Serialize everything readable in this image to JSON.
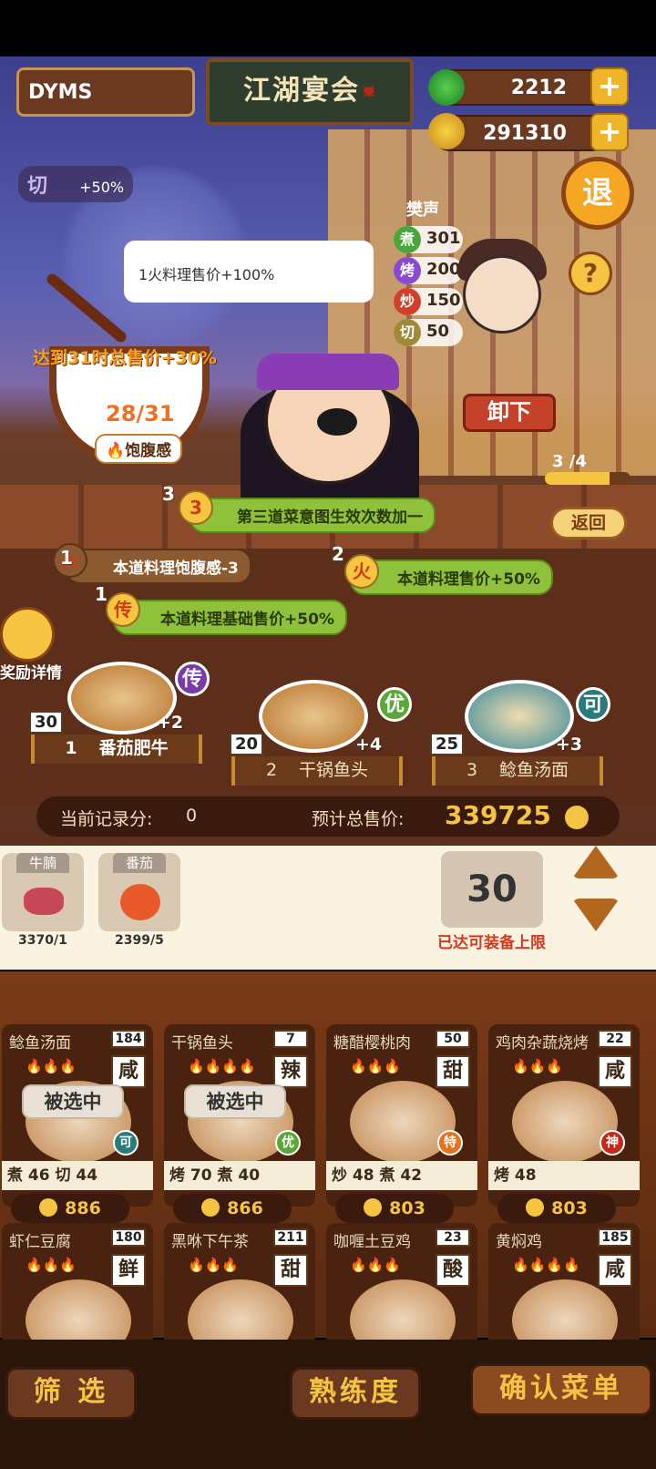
{
  "player": {
    "name": "DYMS"
  },
  "header": {
    "title": "江湖宴会",
    "stamp": "樂"
  },
  "currency": {
    "jade": "2212",
    "coin": "291310",
    "plus": "+"
  },
  "buff_chip": {
    "label": "切",
    "bonus": "+50%"
  },
  "exit_button": "退",
  "help_button": "?",
  "chef": {
    "name": "樊声",
    "stats": [
      {
        "icon": "煮",
        "value": "301",
        "color": "#4aa63a"
      },
      {
        "icon": "烤",
        "value": "200",
        "color": "#8a4ad0"
      },
      {
        "icon": "炒",
        "value": "150",
        "color": "#d0402a"
      },
      {
        "icon": "切",
        "value": "50",
        "color": "#a08a3a"
      }
    ]
  },
  "speech": "1火料理售价+100%",
  "satiety": {
    "bonus": "达到31时总售价+30%",
    "progress": "28/31",
    "label": "饱腹感",
    "current": 28,
    "target": 31
  },
  "unload_button": "卸下",
  "page": {
    "text": "3 /4",
    "current": 3,
    "total": 4
  },
  "back_button": "返回",
  "effects": [
    {
      "num": "3",
      "icon": "3",
      "text": "第三道菜意图生效次数加一",
      "style": "green"
    },
    {
      "num": "1",
      "icon": "火",
      "text": "本道料理饱腹感-3",
      "style": "brown"
    },
    {
      "num": "2",
      "icon": "火",
      "text": "本道料理售价+50%",
      "style": "green"
    },
    {
      "num": "1",
      "icon": "传",
      "text": "本道料理基础售价+50%",
      "style": "green"
    }
  ],
  "reward": {
    "label": "奖励详情"
  },
  "slots": [
    {
      "index": "1",
      "name": "番茄肥牛",
      "count": "30",
      "bonus": "+2",
      "grade": "传",
      "grade_color": "#7a3aa8"
    },
    {
      "index": "2",
      "name": "干锅鱼头",
      "count": "20",
      "bonus": "+4",
      "grade": "优",
      "grade_color": "#5aa83a"
    },
    {
      "index": "3",
      "name": "鲶鱼汤面",
      "count": "25",
      "bonus": "+3",
      "grade": "可",
      "grade_color": "#2a7a7a"
    }
  ],
  "score": {
    "record_label": "当前记录分:",
    "record_value": "0",
    "total_label": "预计总售价:",
    "total_value": "339725"
  },
  "ingredients": [
    {
      "name": "牛腩",
      "count": "3370/1",
      "color": "#c8485a"
    },
    {
      "name": "番茄",
      "count": "2399/5",
      "color": "#e85a2a"
    }
  ],
  "quantity": {
    "value": "30",
    "note": "已达可装备上限"
  },
  "recipes": [
    {
      "name": "鲶鱼汤面",
      "count": "184",
      "flavor": "咸",
      "stars": "🔥🔥🔥",
      "selected": "被选中",
      "grade": "可",
      "grade_color": "#2a7a7a",
      "skills": "煮 46  切 44",
      "price": "886"
    },
    {
      "name": "干锅鱼头",
      "count": "7",
      "flavor": "辣",
      "stars": "🔥🔥🔥🔥",
      "selected": "被选中",
      "grade": "优",
      "grade_color": "#5aa83a",
      "skills": "烤 70  煮 40",
      "price": "866"
    },
    {
      "name": "糖醋樱桃肉",
      "count": "50",
      "flavor": "甜",
      "stars": "🔥🔥🔥",
      "selected": "",
      "grade": "特",
      "grade_color": "#e8701a",
      "skills": "炒 48  煮 42",
      "price": "803"
    },
    {
      "name": "鸡肉杂蔬烧烤",
      "count": "22",
      "flavor": "咸",
      "stars": "🔥🔥🔥",
      "selected": "",
      "grade": "神",
      "grade_color": "#c8281a",
      "skills": "烤 48",
      "price": "803"
    },
    {
      "name": "虾仁豆腐",
      "count": "180",
      "flavor": "鲜",
      "stars": "🔥🔥🔥",
      "selected": "",
      "grade": "",
      "grade_color": "#2a7a7a",
      "skills": "",
      "price": ""
    },
    {
      "name": "黑咻下午茶",
      "count": "211",
      "flavor": "甜",
      "stars": "🔥🔥🔥",
      "selected": "",
      "grade": "",
      "grade_color": "#2a7a7a",
      "skills": "",
      "price": ""
    },
    {
      "name": "咖喱土豆鸡",
      "count": "23",
      "flavor": "酸",
      "stars": "🔥🔥🔥",
      "selected": "",
      "grade": "",
      "grade_color": "#2a7a7a",
      "skills": "",
      "price": ""
    },
    {
      "name": "黄焖鸡",
      "count": "185",
      "flavor": "咸",
      "stars": "🔥🔥🔥🔥",
      "selected": "",
      "grade": "",
      "grade_color": "#2a7a7a",
      "skills": "",
      "price": ""
    }
  ],
  "bottom": {
    "filter": "筛 选",
    "mastery": "熟练度",
    "confirm": "确认菜单"
  }
}
